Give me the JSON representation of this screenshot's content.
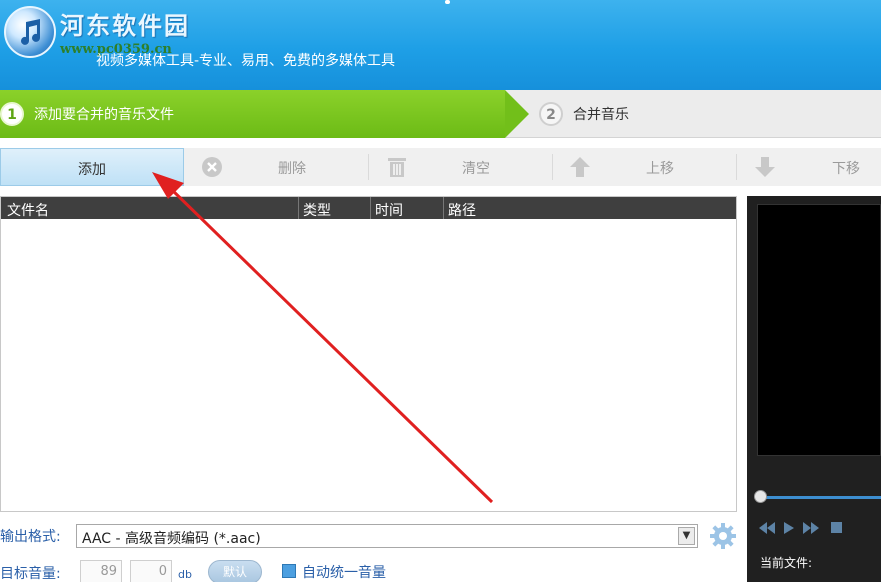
{
  "header": {
    "brand": "河东软件园",
    "brand_url": "www.pc0359.cn",
    "tagline": "视频多媒体工具-专业、易用、免费的多媒体工具"
  },
  "steps": [
    {
      "num": "1",
      "label": "添加要合并的音乐文件",
      "active": true
    },
    {
      "num": "2",
      "label": "合并音乐",
      "active": false
    }
  ],
  "toolbar": {
    "add_label": "添加",
    "delete_label": "删除",
    "clear_label": "清空",
    "up_label": "上移",
    "down_label": "下移"
  },
  "file_list": {
    "columns": [
      "文件名",
      "类型",
      "时间",
      "路径"
    ],
    "rows": []
  },
  "options": {
    "format_label": "输出格式:",
    "format_value": "AAC - 高级音频编码 (*.aac)",
    "volume_label": "目标音量:",
    "volume_value_1": "89",
    "volume_value_2": "0",
    "volume_unit": "db",
    "default_button": "默认",
    "auto_volume_label": "自动统一音量",
    "auto_volume_checked": true
  },
  "preview": {
    "current_file_label": "当前文件:",
    "seek_position": 0
  },
  "colors": {
    "header_blue": "#1e9fe6",
    "step_green": "#72bf1a",
    "annotation_red": "#e02020"
  }
}
